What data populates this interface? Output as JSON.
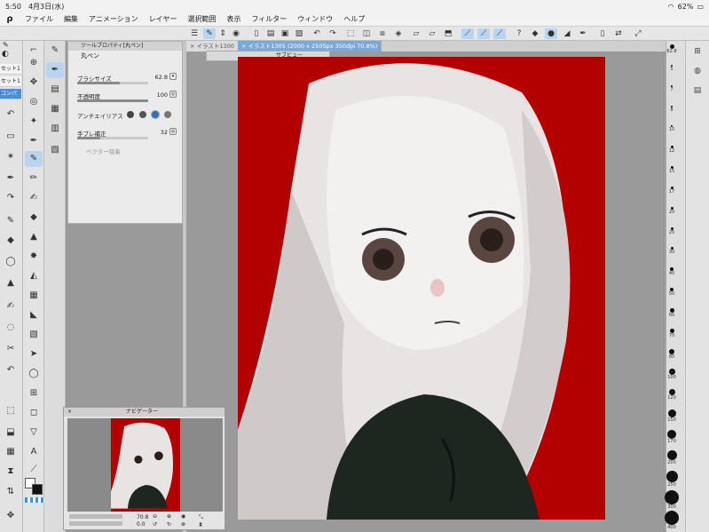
{
  "status": {
    "time": "5:50",
    "date": "4月3日(水)",
    "battery": "62%"
  },
  "menu": [
    "ファイル",
    "編集",
    "アニメーション",
    "レイヤー",
    "選択範囲",
    "表示",
    "フィルター",
    "ウィンドウ",
    "ヘルプ"
  ],
  "subtool": {
    "items": [
      "セット1",
      "セット1",
      "コンパ"
    ]
  },
  "tool_property": {
    "header": "ツールプロパティ[丸ペン]",
    "tool_name": "丸ペン",
    "brush_size_label": "ブラシサイズ",
    "brush_size_value": "62.8",
    "opacity_label": "不透明度",
    "opacity_value": "100",
    "antialias_label": "アンチエイリアス",
    "stabilization_label": "手ブレ補正",
    "stabilization_value": "32",
    "vector_label": "ベクター吸着"
  },
  "tabs": [
    "イラスト1300",
    "イラスト1305 (2000 x 2505px 350dpi 70.8%)"
  ],
  "subview_title": "サブビュー",
  "navigator": {
    "title": "ナビゲーター",
    "zoom": "70.8",
    "rotation": "0.0"
  },
  "brush_sizes": [
    "62.8",
    "5",
    "7",
    "8",
    "10",
    "12",
    "15",
    "17",
    "20",
    "25",
    "30",
    "40",
    "50",
    "60",
    "70",
    "80",
    "100",
    "120",
    "150",
    "170",
    "200",
    "250",
    "300",
    "400"
  ],
  "colors": {
    "accent": "#4a8fd6",
    "canvas_bg": "#b30000"
  }
}
